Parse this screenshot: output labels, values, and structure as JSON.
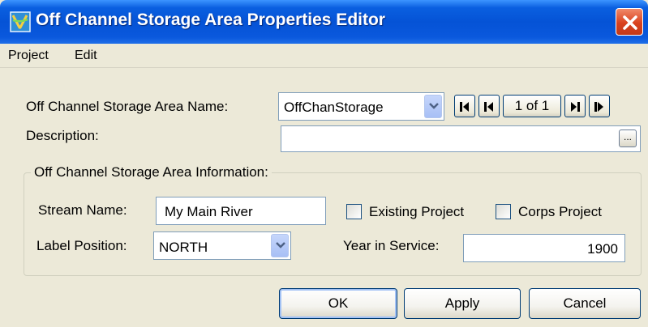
{
  "window": {
    "title": "Off Channel Storage Area Properties Editor"
  },
  "menu": {
    "items": [
      {
        "label": "Project"
      },
      {
        "label": "Edit"
      }
    ]
  },
  "form": {
    "name_label": "Off Channel Storage Area Name:",
    "name_value": "OffChanStorage",
    "record_counter": "1 of 1",
    "description_label": "Description:",
    "description_value": "",
    "browse_label": "...",
    "group_title": "Off Channel Storage Area Information:",
    "stream_name_label": "Stream Name:",
    "stream_name_value": "My Main River",
    "existing_project_label": "Existing Project",
    "existing_project_checked": false,
    "corps_project_label": "Corps Project",
    "corps_project_checked": false,
    "label_position_label": "Label Position:",
    "label_position_value": "NORTH",
    "year_in_service_label": "Year in Service:",
    "year_in_service_value": "1900"
  },
  "buttons": {
    "ok": "OK",
    "apply": "Apply",
    "cancel": "Cancel"
  },
  "colors": {
    "titlebar": "#0553d6",
    "window_bg": "#ece9d8",
    "close_button": "#d9411e"
  },
  "icons": {
    "app": "app-icon",
    "close": "close-icon",
    "first": "first-record-icon",
    "prev": "previous-record-icon",
    "next": "next-record-icon",
    "last": "last-record-icon",
    "dropdown": "chevron-down-icon"
  }
}
